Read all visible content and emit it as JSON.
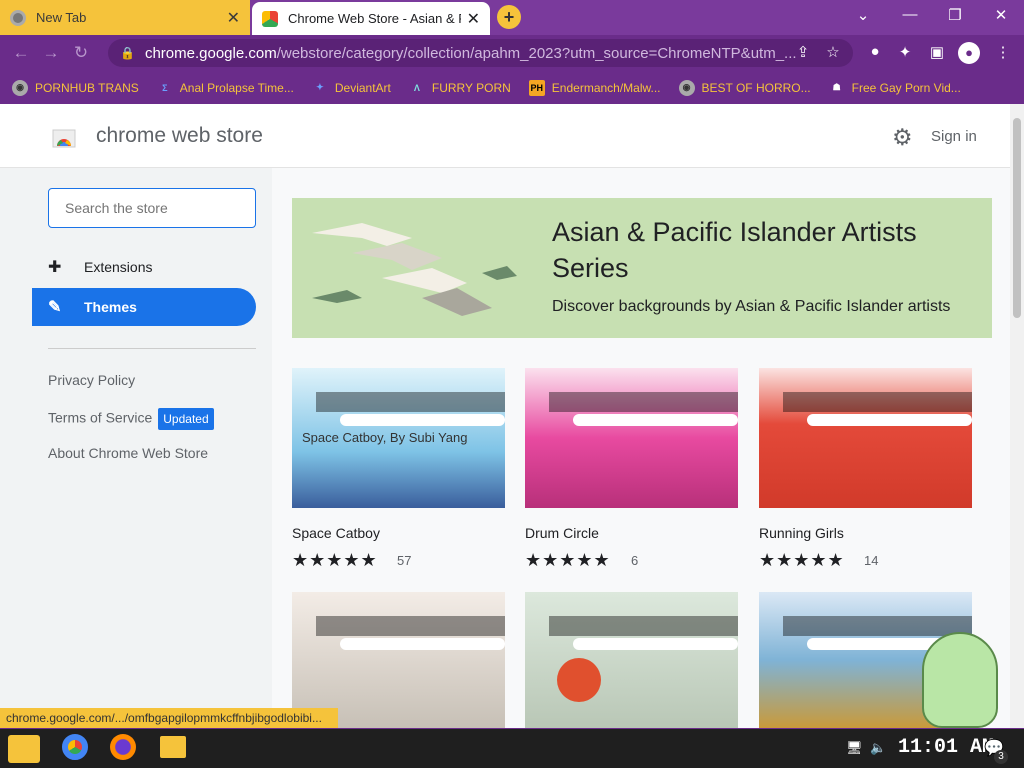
{
  "tabs": [
    {
      "label": "New Tab",
      "close": "✕"
    },
    {
      "label": "Chrome Web Store - Asian & Pacific",
      "close": "✕"
    }
  ],
  "new_tab_symbol": "+",
  "window_controls": [
    "⌄",
    "—",
    "❐",
    "✕"
  ],
  "nav": {
    "back": "←",
    "forward": "→",
    "reload": "↻"
  },
  "url": {
    "host": "chrome.google.com",
    "path": "/webstore/category/collection/apahm_2023?utm_source=ChromeNTP&utm_..."
  },
  "bookmarks": [
    "PORNHUB TRANS",
    "Anal Prolapse Time...",
    "DeviantArt",
    "FURRY PORN",
    "Endermanch/Malw...",
    "BEST OF HORRO...",
    "Free Gay Porn Vid..."
  ],
  "store": {
    "title": "chrome web store",
    "sign_in": "Sign in"
  },
  "search": {
    "placeholder": "Search the store"
  },
  "sidebar": {
    "items": [
      {
        "label": "Extensions",
        "icon": "puzzle-icon"
      },
      {
        "label": "Themes",
        "icon": "brush-icon"
      }
    ],
    "links": [
      "Privacy Policy",
      "Terms of Service",
      "About Chrome Web Store"
    ],
    "badge": "Updated"
  },
  "banner": {
    "title": "Asian & Pacific Islander Artists Series",
    "subtitle": "Discover backgrounds by Asian & Pacific Islander artists"
  },
  "themes": [
    {
      "name": "Space Catboy",
      "stars": "★★★★★",
      "count": "57",
      "overlay": "Space Catboy, By Subi Yang",
      "color": "#6fb3d6"
    },
    {
      "name": "Drum Circle",
      "stars": "★★★★★",
      "count": "6",
      "overlay": "",
      "color": "#e84aa0"
    },
    {
      "name": "Running Girls",
      "stars": "★★★★★",
      "count": "14",
      "overlay": "",
      "color": "#e44a3a"
    },
    {
      "name": "",
      "stars": "",
      "count": "",
      "overlay": "",
      "color": "#c7c0b6"
    },
    {
      "name": "",
      "stars": "",
      "count": "",
      "overlay": "",
      "color": "#b9c7b6"
    },
    {
      "name": "",
      "stars": "",
      "count": "",
      "overlay": "",
      "color": "#7fb3d6"
    }
  ],
  "mini_ui": {
    "tab": "New tab",
    "plus": "+",
    "nav": "← → ↻"
  },
  "status_url": "chrome.google.com/.../omfbgapgilopmmkcffnbjibgodlobibi...",
  "clock": "11:01 AM",
  "notification_count": "3",
  "colors": {
    "accent": "#1a73e8",
    "tabbar": "#7a3a9c",
    "highlight": "#f5c33b"
  }
}
